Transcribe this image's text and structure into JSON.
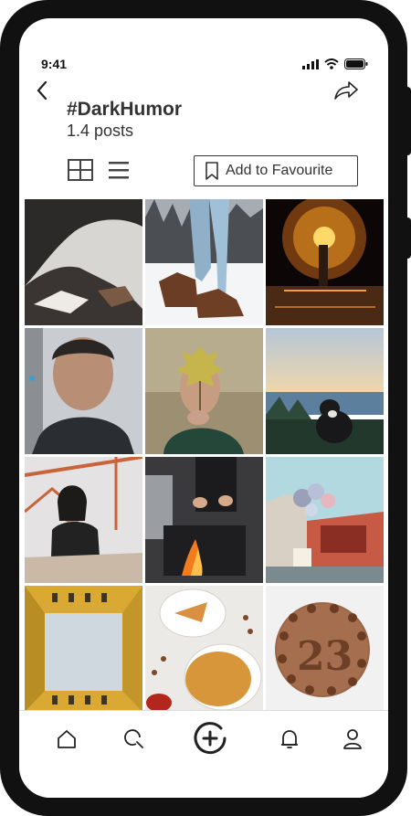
{
  "status_bar": {
    "time": "9:41"
  },
  "header": {
    "title": "#DarkHumor",
    "subtitle": "1.4 posts",
    "favourite_label": "Add to Favourite"
  },
  "icons": {
    "back": "chevron-left-icon",
    "share": "share-arrow-icon",
    "grid_view": "grid-icon",
    "list_view": "list-icon",
    "bookmark": "bookmark-icon"
  },
  "posts": [
    {
      "subject": "rock-cave"
    },
    {
      "subject": "boots-snow"
    },
    {
      "subject": "fire-sparks"
    },
    {
      "subject": "man-haircut"
    },
    {
      "subject": "maple-leaf"
    },
    {
      "subject": "dog-mountains"
    },
    {
      "subject": "woman-bridge"
    },
    {
      "subject": "cooking-fire"
    },
    {
      "subject": "balloons-street"
    },
    {
      "subject": "building-sky"
    },
    {
      "subject": "pie-table"
    },
    {
      "subject": "chocolate-cake"
    }
  ],
  "bottom_nav": [
    "home-icon",
    "search-icon",
    "add-post-icon",
    "notification-bell-icon",
    "profile-icon"
  ]
}
